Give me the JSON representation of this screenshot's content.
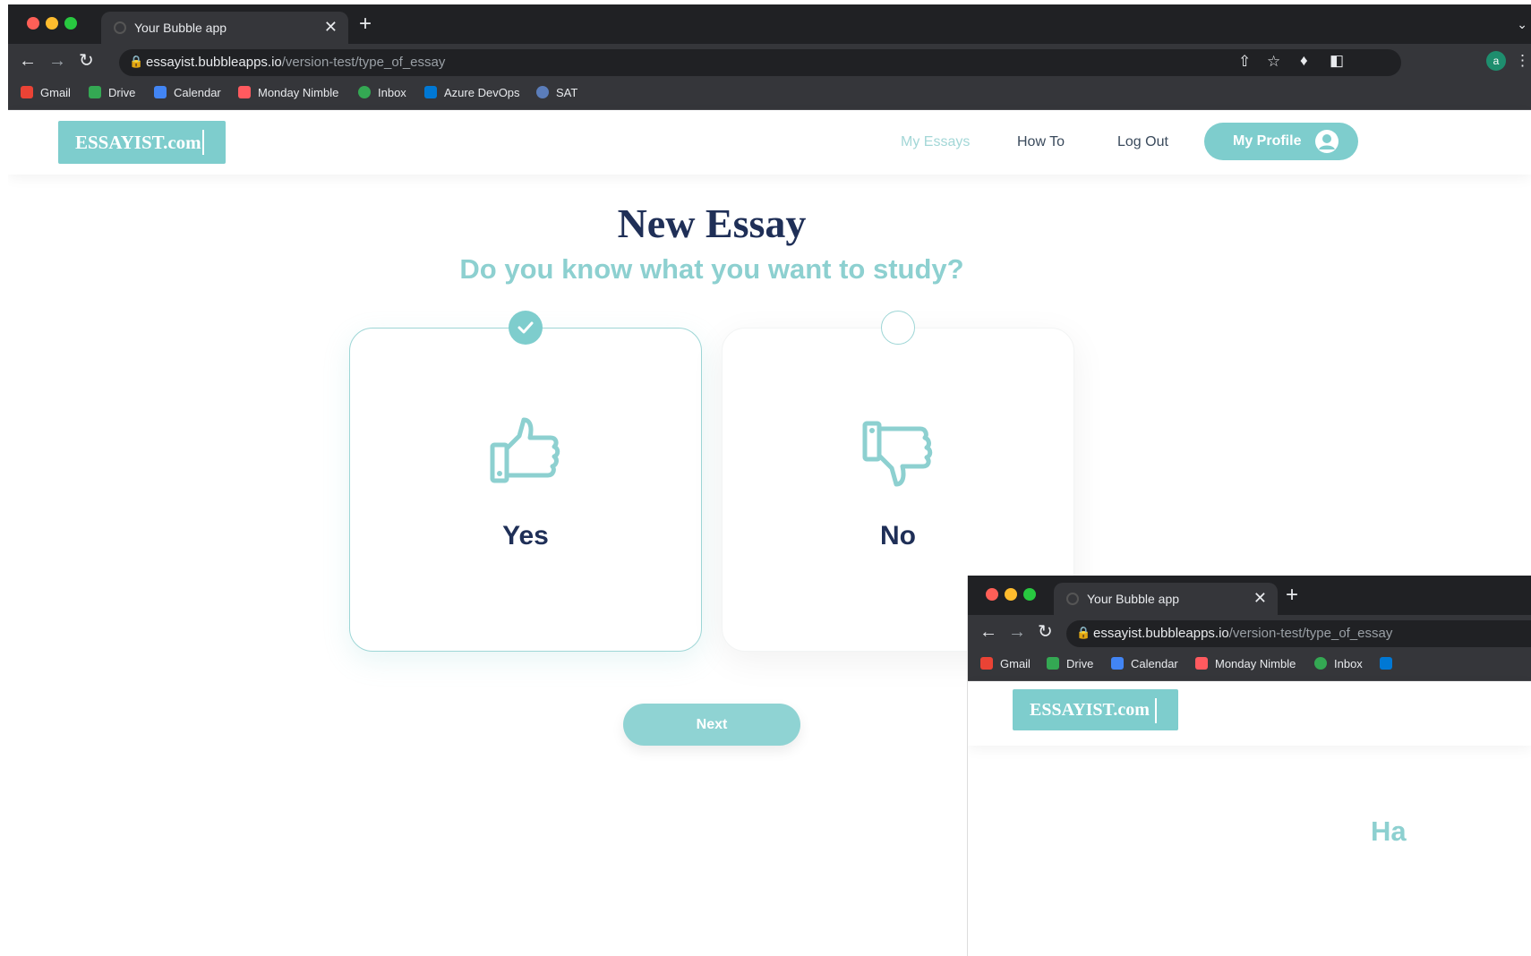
{
  "browser": {
    "tab_title": "Your Bubble app",
    "tab_close": "✕",
    "new_tab": "+",
    "url_domain": "essayist.bubbleapps.io",
    "url_path": "/version-test/type_of_essay",
    "profile_initial": "a",
    "bookmarks": [
      {
        "label": "Gmail",
        "icon": "gmail-icon",
        "color": "#ea4335"
      },
      {
        "label": "Drive",
        "icon": "drive-icon",
        "color": "#34a853"
      },
      {
        "label": "Calendar",
        "icon": "calendar-icon",
        "color": "#4285f4"
      },
      {
        "label": "Monday Nimble",
        "icon": "monday-icon",
        "color": "#ff5a5f"
      },
      {
        "label": "Inbox",
        "icon": "inbox-icon",
        "color": "#34a853"
      },
      {
        "label": "Azure DevOps",
        "icon": "azure-devops-icon",
        "color": "#0078d4"
      },
      {
        "label": "SAT",
        "icon": "sat-icon",
        "color": "#5b7dba"
      }
    ]
  },
  "header": {
    "logo_text": "ESSAYIST.com",
    "nav": [
      "My Essays",
      "How To",
      "Log Out"
    ],
    "active_nav": "My Essays",
    "profile_button": "My Profile"
  },
  "main": {
    "title": "New Essay",
    "subtitle": "Do you know what you want to study?",
    "options": [
      {
        "label": "Yes",
        "selected": true,
        "icon": "thumbs-up-icon"
      },
      {
        "label": "No",
        "selected": false,
        "icon": "thumbs-down-icon"
      }
    ],
    "next_button": "Next"
  },
  "second_window": {
    "tab_title": "Your Bubble app",
    "url_domain": "essayist.bubbleapps.io",
    "url_path": "/version-test/type_of_essay",
    "bookmarks": [
      "Gmail",
      "Drive",
      "Calendar",
      "Monday Nimble",
      "Inbox"
    ],
    "logo_text": "ESSAYIST.com",
    "partial_heading": "Ha"
  },
  "colors": {
    "accent": "#7ecdcd",
    "title": "#1f2f57",
    "subtitle": "#8dd0d0",
    "chrome_dark": "#202124",
    "chrome_mid": "#35363a"
  }
}
